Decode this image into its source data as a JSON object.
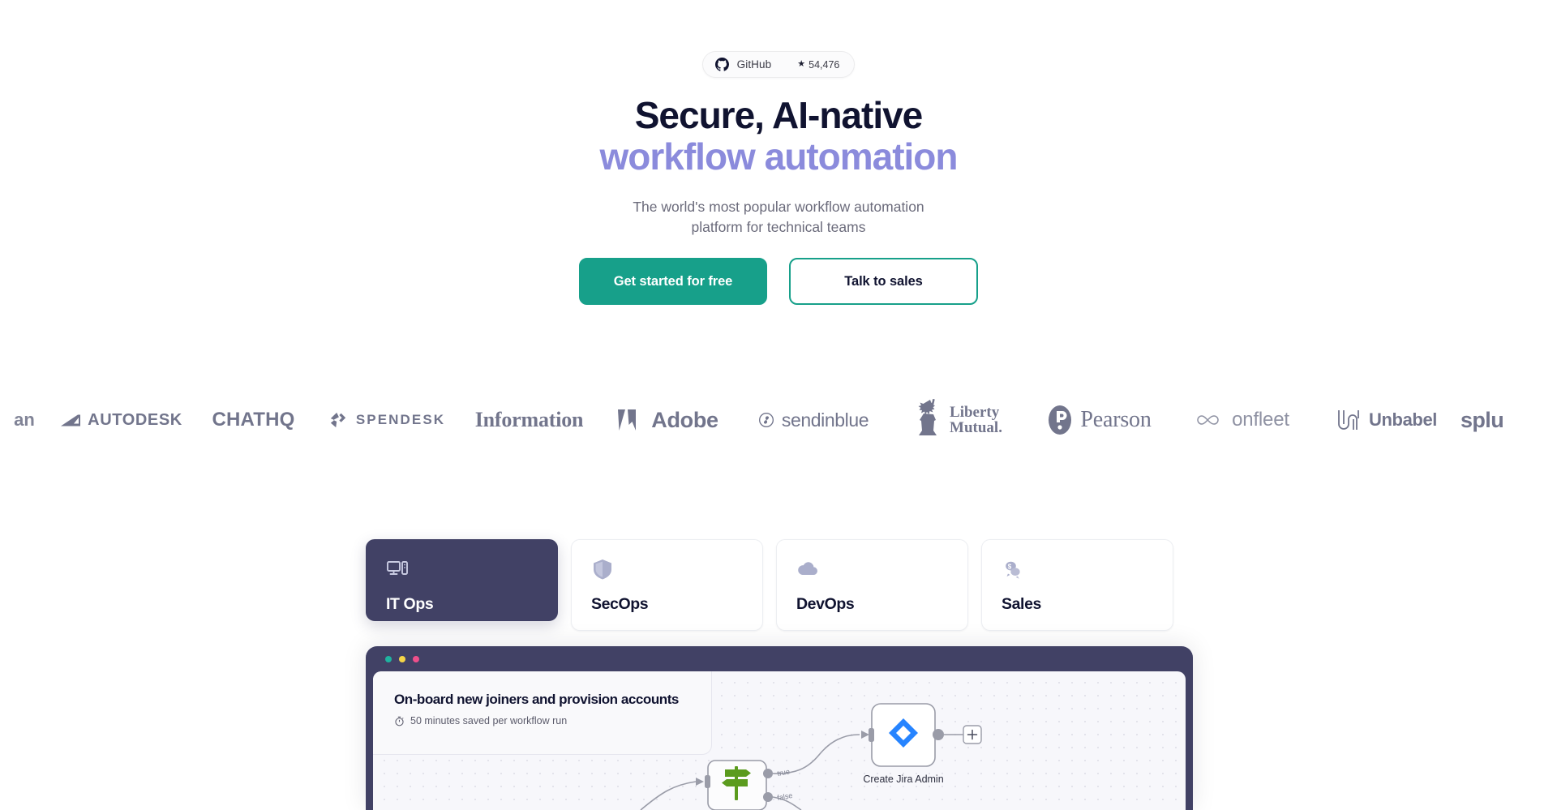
{
  "github_badge": {
    "icon": "github-icon",
    "name": "GitHub",
    "star_glyph": "★",
    "stars": "54,476"
  },
  "hero": {
    "headline_line1": "Secure, AI-native",
    "headline_line2": "workflow automation",
    "subtitle": "The world's most popular workflow automation platform for technical teams",
    "accent_color": "#8b8bdc",
    "heading_color": "#101330"
  },
  "cta": {
    "primary_label": "Get started for free",
    "primary_color": "#17a08a",
    "secondary_label": "Talk to sales",
    "secondary_border_color": "#17a08a"
  },
  "logos": [
    {
      "name": "pan",
      "label": "an",
      "partial": true
    },
    {
      "name": "autodesk",
      "label": "AUTODESK"
    },
    {
      "name": "chathq",
      "label": "CHATHQ"
    },
    {
      "name": "spendesk",
      "label": "SPENDESK"
    },
    {
      "name": "information",
      "label": "Information"
    },
    {
      "name": "adobe",
      "label": "Adobe"
    },
    {
      "name": "sendinblue",
      "label": "sendinblue"
    },
    {
      "name": "liberty-mutual",
      "label_line1": "Liberty",
      "label_line2": "Mutual."
    },
    {
      "name": "pearson",
      "label": "Pearson"
    },
    {
      "name": "onfleet",
      "label": "onfleet"
    },
    {
      "name": "unbabel",
      "label": "Unbabel"
    },
    {
      "name": "splunk",
      "label": "splu",
      "partial": true
    }
  ],
  "tabs": [
    {
      "id": "it-ops",
      "label": "IT Ops",
      "icon": "monitor-icon",
      "active": true
    },
    {
      "id": "secops",
      "label": "SecOps",
      "icon": "shield-icon",
      "active": false
    },
    {
      "id": "devops",
      "label": "DevOps",
      "icon": "cloud-icon",
      "active": false
    },
    {
      "id": "sales",
      "label": "Sales",
      "icon": "chat-dollar-icon",
      "active": false
    }
  ],
  "workflow": {
    "window_color": "#414165",
    "traffic_lights": [
      "#1fb3a0",
      "#f5d547",
      "#ef4f8b"
    ],
    "title": "On-board new joiners and provision accounts",
    "meta_icon": "timer-icon",
    "meta": "50 minutes saved per workflow run",
    "nodes": [
      {
        "id": "switch-node",
        "icon": "signpost-icon",
        "caption": ""
      },
      {
        "id": "jira-node",
        "icon": "jira-icon",
        "caption": "Create Jira Admin"
      },
      {
        "id": "add-node-button",
        "icon": "plus-icon",
        "caption": "+"
      }
    ],
    "edge_labels": [
      "true",
      "false"
    ]
  }
}
